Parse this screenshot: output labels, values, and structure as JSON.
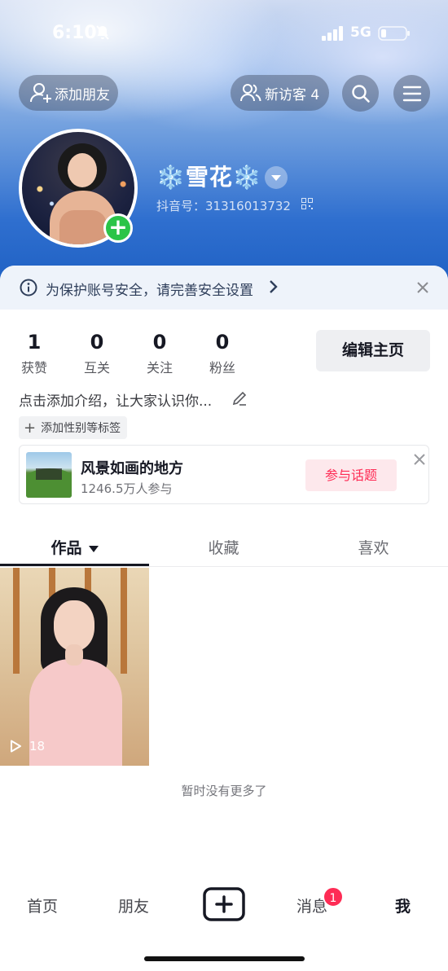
{
  "status_bar": {
    "time": "6:10",
    "network": "5G"
  },
  "header": {
    "add_friend_label": "添加朋友",
    "visitors_label": "新访客 4"
  },
  "profile": {
    "nickname": "❄️雪花❄️",
    "douyin_id": "抖音号：31316013732"
  },
  "security_banner": {
    "text": "为保护账号安全，请完善安全设置"
  },
  "stats": [
    {
      "value": "1",
      "label": "获赞"
    },
    {
      "value": "0",
      "label": "互关"
    },
    {
      "value": "0",
      "label": "关注"
    },
    {
      "value": "0",
      "label": "粉丝"
    }
  ],
  "edit_profile_label": "编辑主页",
  "bio_placeholder": "点击添加介绍，让大家认识你...",
  "add_tags_label": "添加性别等标签",
  "topic": {
    "title": "风景如画的地方",
    "participants": "1246.5万人参与",
    "join_label": "参与话题"
  },
  "tabs": [
    {
      "label": "作品",
      "active": true
    },
    {
      "label": "收藏",
      "active": false
    },
    {
      "label": "喜欢",
      "active": false
    }
  ],
  "videos": [
    {
      "play_count": "18"
    }
  ],
  "empty_text": "暂时没有更多了",
  "bottom_nav": {
    "items": [
      {
        "label": "首页"
      },
      {
        "label": "朋友"
      },
      {
        "label": "消息",
        "badge": "1"
      },
      {
        "label": "我",
        "active": true
      }
    ]
  },
  "colors": {
    "accent": "#fe2c55",
    "green_plus": "#2bc448",
    "hero_blue": "#2f6fcf"
  }
}
